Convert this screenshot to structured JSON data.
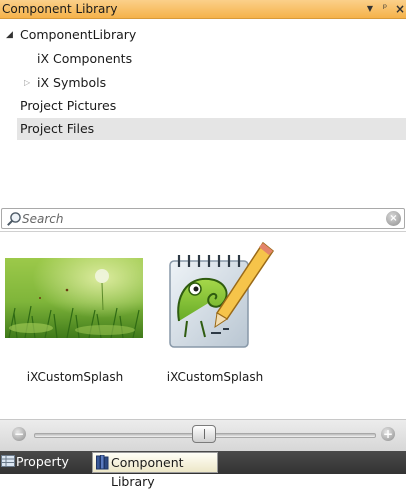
{
  "window": {
    "title": "Component Library",
    "controls": {
      "dropdown": "▾",
      "pin": "ᵖ",
      "close": "×"
    }
  },
  "tree": {
    "root": {
      "label": "ComponentLibrary",
      "expanded": true
    },
    "children": [
      {
        "label": "iX Components"
      },
      {
        "label": "iX Symbols",
        "expandable": true
      }
    ],
    "items": [
      {
        "label": "Project Pictures"
      },
      {
        "label": "Project Files",
        "selected": true
      }
    ]
  },
  "search": {
    "placeholder": "Search",
    "value": ""
  },
  "gallery": {
    "items": [
      {
        "label": "iXCustomSplash",
        "icon": "grass-dandelion-image"
      },
      {
        "label": "iXCustomSplash",
        "icon": "chameleon-notepad-image"
      }
    ]
  },
  "zoom": {
    "level": 0.5
  },
  "tabs": [
    {
      "label": "Property Grid",
      "icon": "property-grid-icon",
      "active": false
    },
    {
      "label": "Component Library",
      "icon": "books-icon",
      "active": true
    }
  ],
  "colors": {
    "title_bar": "#f5b24a",
    "selection": "#e5e5e5",
    "tab_bar": "#3b3b3b",
    "active_tab": "#f6f2dc"
  }
}
